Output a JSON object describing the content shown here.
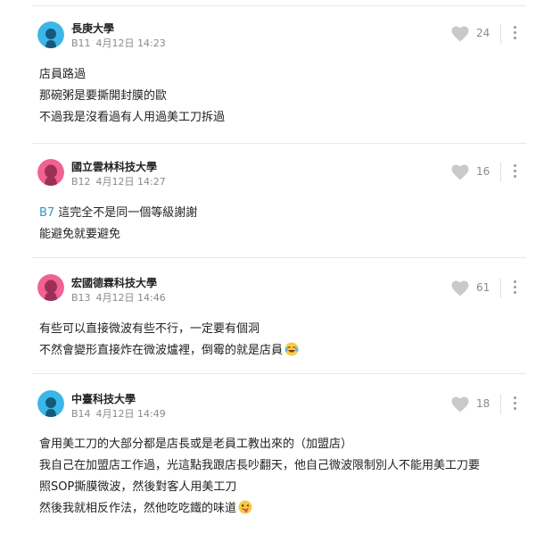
{
  "comments": [
    {
      "school": "長庚大學",
      "floor": "B11",
      "time": "4月12日 14:23",
      "likes": "24",
      "avatar_color": "#3bb6e8",
      "lines": [
        "店員路過",
        "那碗粥是要撕開封膜的歐",
        "不過我是沒看過有人用過美工刀拆過"
      ]
    },
    {
      "school": "國立雲林科技大學",
      "floor": "B12",
      "time": "4月12日 14:27",
      "likes": "16",
      "avatar_color": "#f06292",
      "reply_ref": "B7",
      "lines": [
        "這完全不是同一個等級謝謝",
        "能避免就要避免"
      ]
    },
    {
      "school": "宏國德霖科技大學",
      "floor": "B13",
      "time": "4月12日 14:46",
      "likes": "61",
      "avatar_color": "#f06292",
      "lines": [
        "有些可以直接微波有些不行，一定要有個洞",
        "不然會變形直接炸在微波爐裡，倒霉的就是店員"
      ]
    },
    {
      "school": "中臺科技大學",
      "floor": "B14",
      "time": "4月12日 14:49",
      "likes": "18",
      "avatar_color": "#3bb6e8",
      "lines": [
        "會用美工刀的大部分都是店長或是老員工教出來的（加盟店）",
        "我自己在加盟店工作過，光這點我跟店長吵翻天，他自己微波限制別人不能用美工刀要",
        "照SOP撕膜微波，然後對客人用美工刀",
        "然後我就相反作法，然他吃吃鐵的味道"
      ]
    }
  ],
  "icons": {
    "like": "heart-icon",
    "more": "more-vertical-icon",
    "avatar": "user-silhouette-icon",
    "emoji_b13": "laughing-tears-emoji",
    "emoji_b14": "tongue-wink-emoji"
  }
}
